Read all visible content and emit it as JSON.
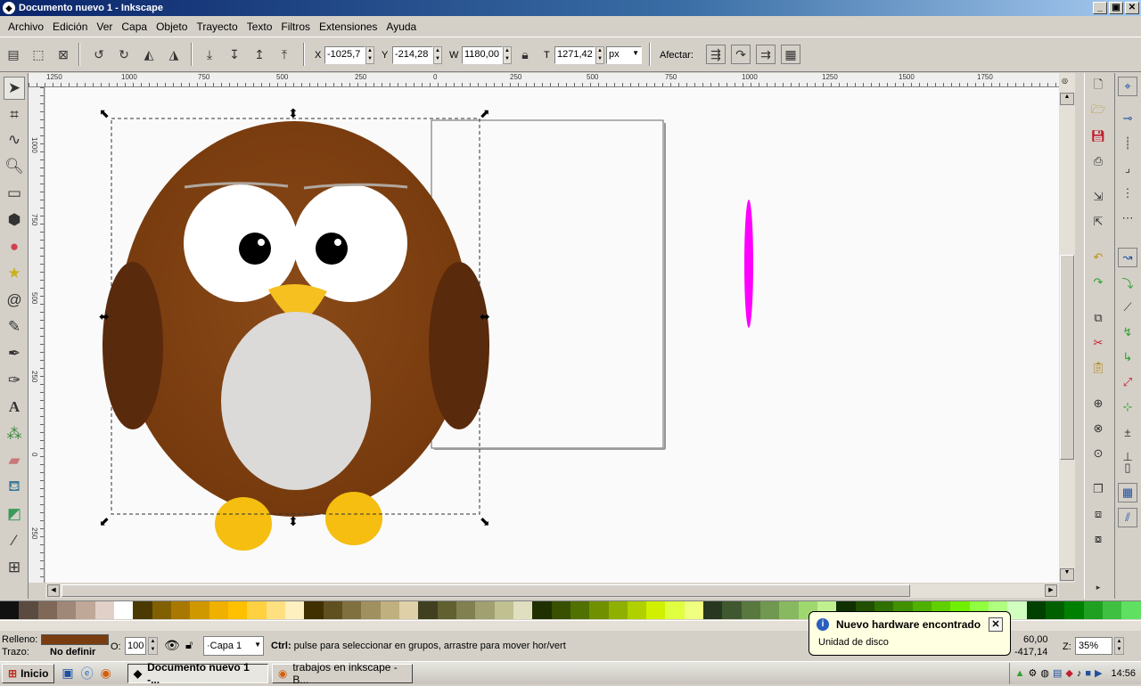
{
  "window": {
    "title": "Documento nuevo 1 - Inkscape",
    "minimize": "_",
    "maximize": "▣",
    "close": "✕"
  },
  "menu": [
    "Archivo",
    "Edición",
    "Ver",
    "Capa",
    "Objeto",
    "Trayecto",
    "Texto",
    "Filtros",
    "Extensiones",
    "Ayuda"
  ],
  "toolbar": {
    "x_label": "X",
    "x_value": "-1025,7",
    "y_label": "Y",
    "y_value": "-214,28",
    "w_label": "W",
    "w_value": "1180,00",
    "h_label": "T",
    "h_value": "1271,42",
    "unit": "px",
    "affect_label": "Afectar:"
  },
  "ruler_h": [
    "1250",
    "1000",
    "750",
    "500",
    "250",
    "0",
    "250",
    "500",
    "750",
    "1000",
    "1250",
    "1500",
    "1750"
  ],
  "ruler_v": [
    "1000",
    "750",
    "500",
    "250",
    "0",
    "250"
  ],
  "status": {
    "fill_label": "Relleno:",
    "fill_color": "#7a3d10",
    "stroke_label": "Trazo:",
    "stroke_value": "No definir",
    "opacity_label": "O:",
    "opacity_value": "100",
    "layer": "·Capa 1",
    "message_bold": "Ctrl:",
    "message": " pulse para seleccionar en grupos, arrastre para mover hor/vert",
    "coord_x": "60,00",
    "coord_y": "-417,14",
    "zoom_label": "Z:",
    "zoom_value": "35%"
  },
  "balloon": {
    "title": "Nuevo hardware encontrado",
    "text": "Unidad de disco",
    "close": "✕"
  },
  "taskbar": {
    "start": "Inicio",
    "tasks": [
      "Documento nuevo 1 -...",
      "trabajos en inkscape - B..."
    ],
    "clock": "14:56"
  },
  "palette": [
    "#111111",
    "#5a4a40",
    "#806858",
    "#a08878",
    "#c0a898",
    "#e0d0c8",
    "#ffffff",
    "#4a3a00",
    "#806000",
    "#a87800",
    "#d09800",
    "#f0b000",
    "#ffc000",
    "#ffd040",
    "#ffe080",
    "#fff0c0",
    "#403000",
    "#605020",
    "#807040",
    "#a09060",
    "#c0b080",
    "#e0d0a8",
    "#404020",
    "#606030",
    "#808050",
    "#a0a070",
    "#c0c090",
    "#e0e0c0",
    "#203000",
    "#385000",
    "#507000",
    "#709000",
    "#90b000",
    "#b0d000",
    "#d0f000",
    "#e0ff40",
    "#f0ff80",
    "#283820",
    "#405830",
    "#587840",
    "#709850",
    "#88b860",
    "#a0d870",
    "#c0f090",
    "#103000",
    "#205000",
    "#307000",
    "#409000",
    "#50b000",
    "#60d000",
    "#70f000",
    "#90ff40",
    "#b0ff80",
    "#d0ffc0",
    "#004000",
    "#006000",
    "#008000",
    "#20a020",
    "#40c040",
    "#60e060"
  ]
}
